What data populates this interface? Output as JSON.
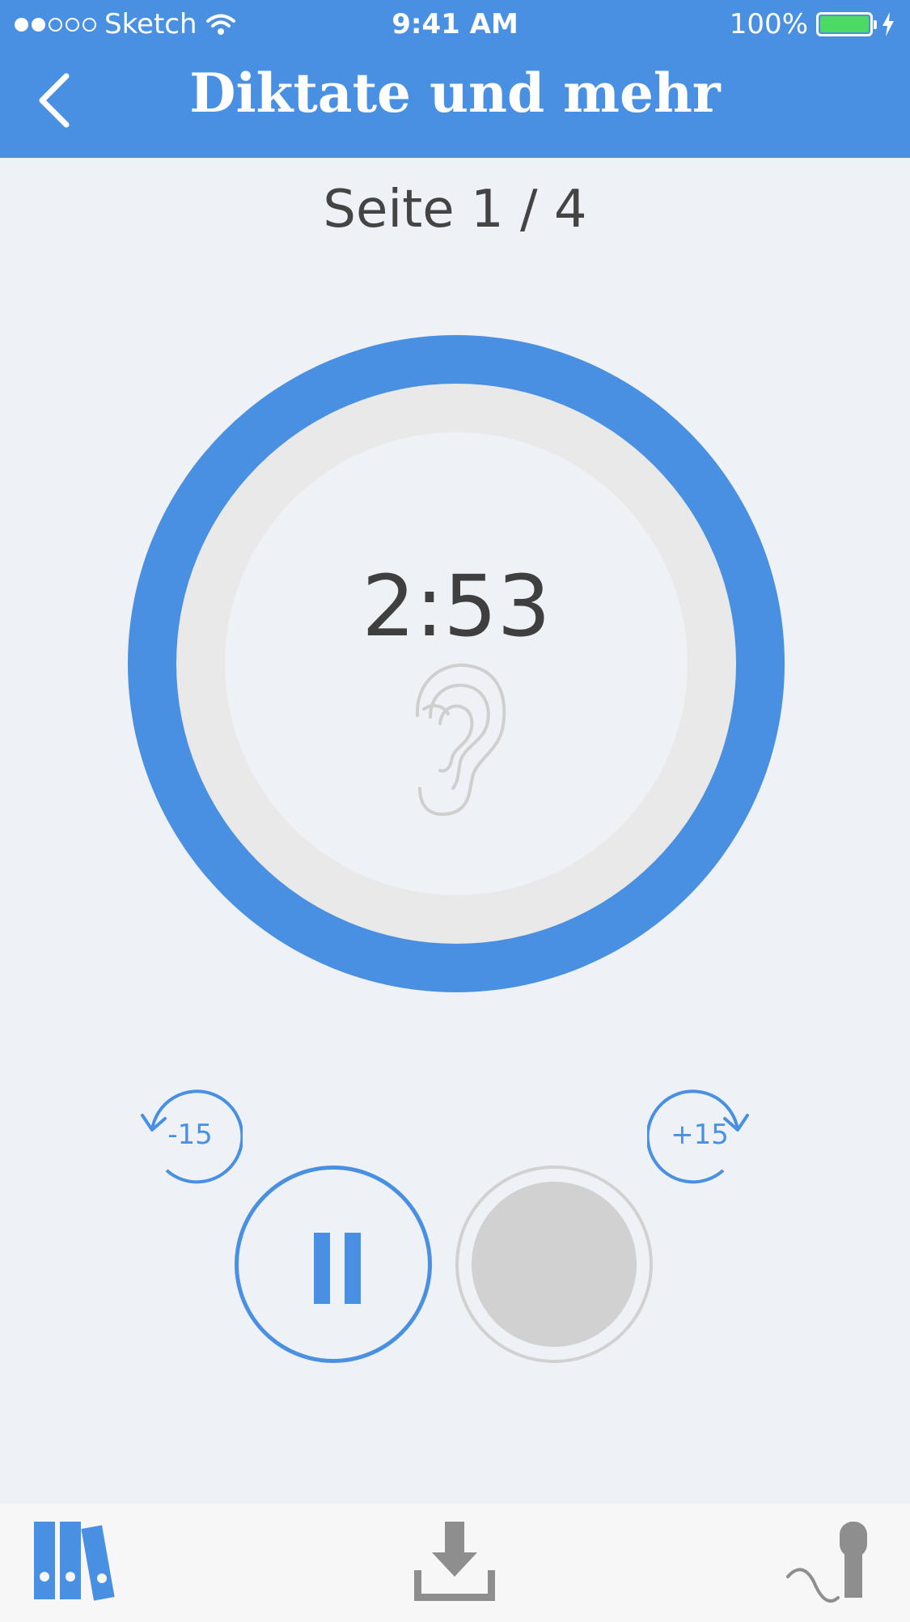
{
  "status_bar": {
    "carrier": "Sketch",
    "time": "9:41 AM",
    "battery": "100%"
  },
  "nav": {
    "title": "Diktate und mehr",
    "back_icon": "chevron-left-icon"
  },
  "page_indicator": "Seite 1 / 4",
  "player": {
    "time": "2:53",
    "ring_icon": "ear-icon",
    "skip_back_label": "-15",
    "skip_forward_label": "+15",
    "pause_icon": "pause-icon",
    "record_icon": "record-icon"
  },
  "tabbar": {
    "items": [
      {
        "icon": "library-icon"
      },
      {
        "icon": "download-icon"
      },
      {
        "icon": "microphone-icon"
      }
    ]
  },
  "colors": {
    "accent": "#4a90e2",
    "background": "#eef1f5",
    "ring_track": "#e9e9ea",
    "disabled": "#d1d1d1",
    "battery_fill": "#4cd964",
    "icon_gray": "#8e8e8e"
  }
}
